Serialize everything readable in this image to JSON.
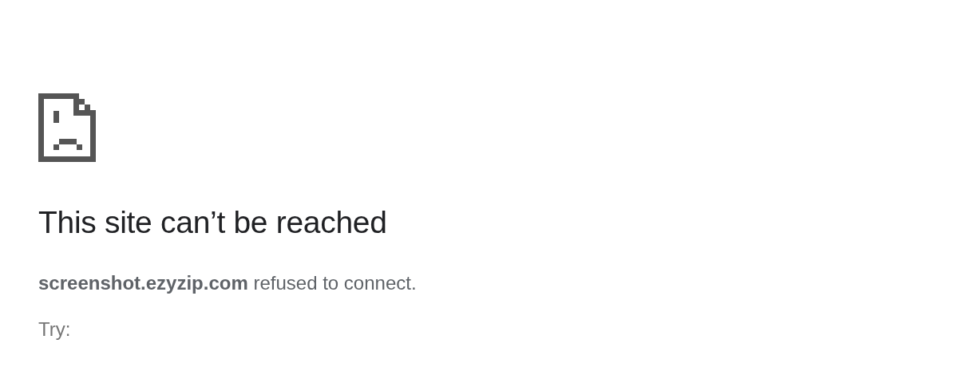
{
  "heading": "This site can’t be reached",
  "message": "**screenshot.ezyzip.com** refused to connect.",
  "suggestions_label": "Try:"
}
